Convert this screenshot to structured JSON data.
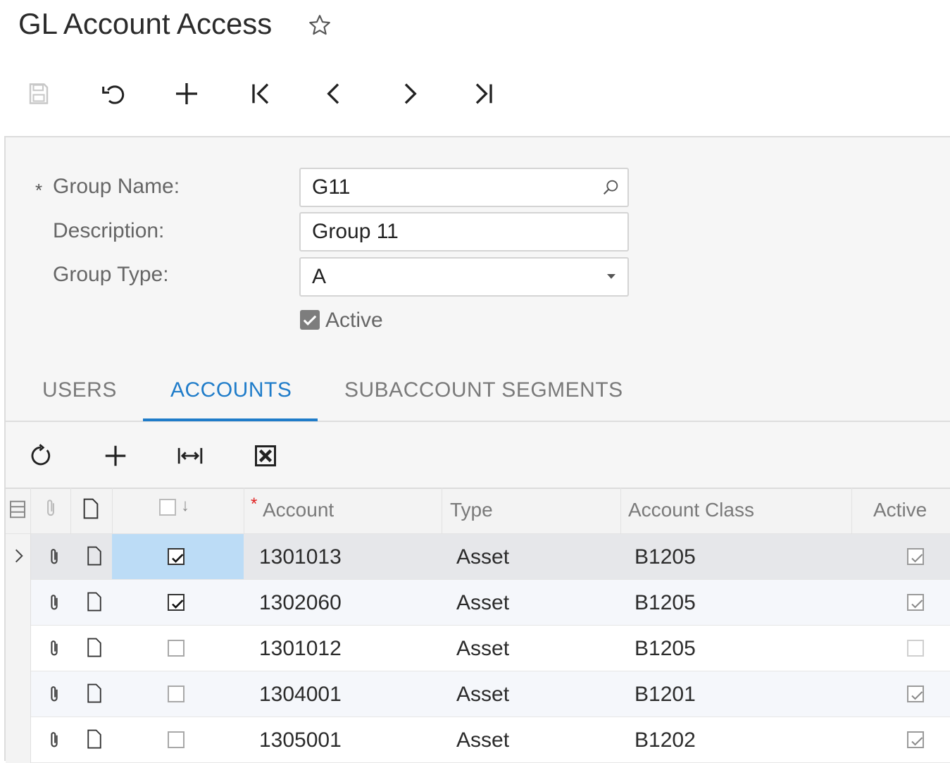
{
  "title": "GL Account Access",
  "icons": {
    "favorite": "star-outline-icon",
    "toolbar": [
      "save-icon",
      "undo-icon",
      "add-icon",
      "first-record-icon",
      "previous-icon",
      "next-icon",
      "last-record-icon"
    ],
    "grid_toolbar": [
      "refresh-icon",
      "add-row-icon",
      "fit-columns-icon",
      "export-excel-icon"
    ]
  },
  "form": {
    "group_name": {
      "label": "Group Name:",
      "required_marker": "*",
      "value": "G11"
    },
    "description": {
      "label": "Description:",
      "value": "Group 11"
    },
    "group_type": {
      "label": "Group Type:",
      "value": "A"
    },
    "active": {
      "label": "Active",
      "checked": true
    }
  },
  "tabs": [
    {
      "label": "USERS",
      "active": false
    },
    {
      "label": "ACCOUNTS",
      "active": true
    },
    {
      "label": "SUBACCOUNT SEGMENTS",
      "active": false
    }
  ],
  "grid": {
    "columns": {
      "account": "Account",
      "account_required_marker": "*",
      "type": "Type",
      "account_class": "Account Class",
      "active": "Active"
    },
    "rows": [
      {
        "selected": true,
        "account": "1301013",
        "type": "Asset",
        "account_class": "B1205",
        "active": true,
        "current": true
      },
      {
        "selected": true,
        "account": "1302060",
        "type": "Asset",
        "account_class": "B1205",
        "active": true,
        "current": false
      },
      {
        "selected": false,
        "account": "1301012",
        "type": "Asset",
        "account_class": "B1205",
        "active": false,
        "current": false
      },
      {
        "selected": false,
        "account": "1304001",
        "type": "Asset",
        "account_class": "B1201",
        "active": true,
        "current": false
      },
      {
        "selected": false,
        "account": "1305001",
        "type": "Asset",
        "account_class": "B1202",
        "active": true,
        "current": false
      }
    ]
  },
  "colors": {
    "accent": "#1f7cc9",
    "current_row": "#e6e7ea",
    "selected_cell": "#bcdcf6",
    "alt_row": "#f5f7fb",
    "required": "#e02020"
  }
}
